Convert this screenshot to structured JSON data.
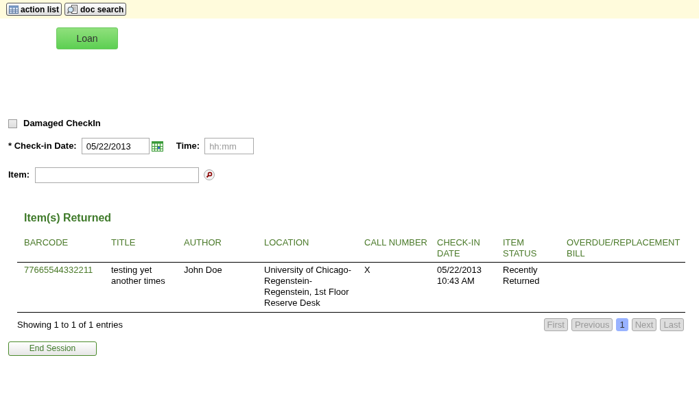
{
  "toolbar": [
    {
      "label": "action list",
      "kind": "table"
    },
    {
      "label": "doc search",
      "kind": "search"
    }
  ],
  "loan_button": "Loan",
  "damaged_checkin": {
    "label": "Damaged CheckIn",
    "checked": false
  },
  "checkin_date": {
    "label": "* Check-in Date:",
    "value": "05/22/2013"
  },
  "time": {
    "label": "Time:",
    "placeholder": "hh:mm"
  },
  "item": {
    "label": "Item:"
  },
  "section_title": "Item(s) Returned",
  "table": {
    "columns": [
      "BARCODE",
      "TITLE",
      "AUTHOR",
      "LOCATION",
      "CALL NUMBER",
      "CHECK-IN DATE",
      "ITEM STATUS",
      "OVERDUE/REPLACEMENT BILL"
    ],
    "rows": [
      [
        "77665544332211",
        "testing yet another times",
        "John Doe",
        "University of Chicago-Regenstein-Regenstein, 1st Floor Reserve Desk",
        "X",
        "05/22/2013 10:43 AM",
        "Recently Returned",
        ""
      ]
    ]
  },
  "table_info": "Showing 1 to 1 of 1 entries",
  "pagination": [
    {
      "label": "First",
      "selected": false,
      "disabled": true
    },
    {
      "label": "Previous",
      "selected": false,
      "disabled": true
    },
    {
      "label": "1",
      "selected": true,
      "disabled": false
    },
    {
      "label": "Next",
      "selected": false,
      "disabled": true
    },
    {
      "label": "Last",
      "selected": false,
      "disabled": true
    }
  ],
  "end_session_button": "End Session"
}
